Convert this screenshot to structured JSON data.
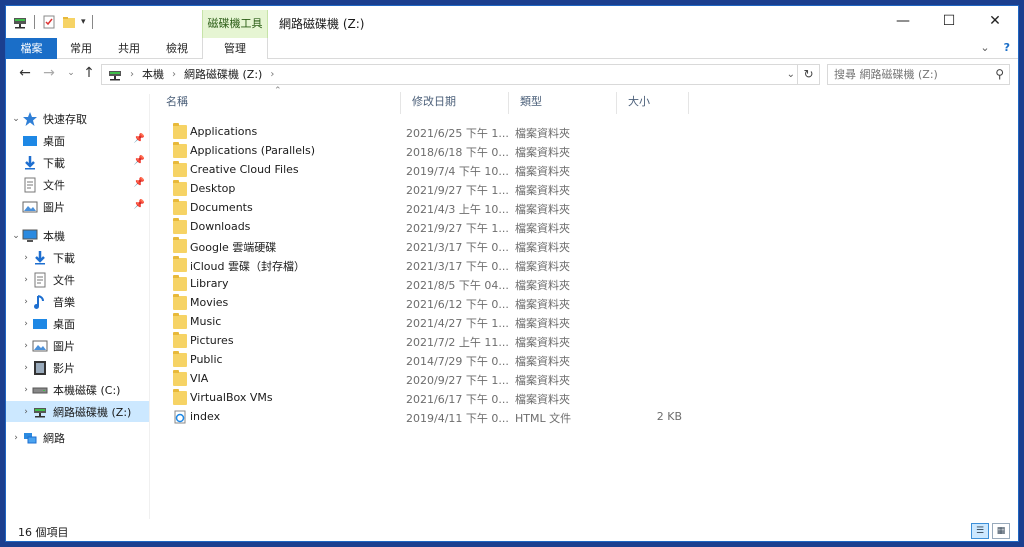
{
  "window": {
    "title": "網路磁碟機 (Z:)",
    "context_group": "磁碟機工具"
  },
  "ribbon": {
    "tabs": [
      "檔案",
      "常用",
      "共用",
      "檢視",
      "管理"
    ]
  },
  "address": {
    "crumbs": [
      "本機",
      "網路磁碟機 (Z:)"
    ],
    "search_placeholder": "搜尋 網路磁碟機 (Z:)"
  },
  "nav": {
    "quick_access": "快速存取",
    "quick_items": [
      "桌面",
      "下載",
      "文件",
      "圖片"
    ],
    "this_pc": "本機",
    "pc_items": [
      "下載",
      "文件",
      "音樂",
      "桌面",
      "圖片",
      "影片",
      "本機磁碟 (C:)",
      "網路磁碟機 (Z:)"
    ],
    "network": "網路"
  },
  "columns": {
    "name": "名稱",
    "date": "修改日期",
    "type": "類型",
    "size": "大小"
  },
  "files": [
    {
      "name": "Applications",
      "date": "2021/6/25 下午 1...",
      "type": "檔案資料夾",
      "size": ""
    },
    {
      "name": "Applications (Parallels)",
      "date": "2018/6/18 下午 0...",
      "type": "檔案資料夾",
      "size": ""
    },
    {
      "name": "Creative Cloud Files",
      "date": "2019/7/4 下午 10...",
      "type": "檔案資料夾",
      "size": ""
    },
    {
      "name": "Desktop",
      "date": "2021/9/27 下午 1...",
      "type": "檔案資料夾",
      "size": ""
    },
    {
      "name": "Documents",
      "date": "2021/4/3 上午 10...",
      "type": "檔案資料夾",
      "size": ""
    },
    {
      "name": "Downloads",
      "date": "2021/9/27 下午 1...",
      "type": "檔案資料夾",
      "size": ""
    },
    {
      "name": "Google 雲端硬碟",
      "date": "2021/3/17 下午 0...",
      "type": "檔案資料夾",
      "size": ""
    },
    {
      "name": "iCloud 雲碟（封存檔）",
      "date": "2021/3/17 下午 0...",
      "type": "檔案資料夾",
      "size": ""
    },
    {
      "name": "Library",
      "date": "2021/8/5 下午 04...",
      "type": "檔案資料夾",
      "size": ""
    },
    {
      "name": "Movies",
      "date": "2021/6/12 下午 0...",
      "type": "檔案資料夾",
      "size": ""
    },
    {
      "name": "Music",
      "date": "2021/4/27 下午 1...",
      "type": "檔案資料夾",
      "size": ""
    },
    {
      "name": "Pictures",
      "date": "2021/7/2 上午 11...",
      "type": "檔案資料夾",
      "size": ""
    },
    {
      "name": "Public",
      "date": "2014/7/29 下午 0...",
      "type": "檔案資料夾",
      "size": ""
    },
    {
      "name": "VIA",
      "date": "2020/9/27 下午 1...",
      "type": "檔案資料夾",
      "size": ""
    },
    {
      "name": "VirtualBox VMs",
      "date": "2021/6/17 下午 0...",
      "type": "檔案資料夾",
      "size": ""
    },
    {
      "name": "index",
      "date": "2019/4/11 下午 0...",
      "type": "HTML 文件",
      "size": "2 KB"
    }
  ],
  "status": {
    "count": "16 個項目"
  }
}
